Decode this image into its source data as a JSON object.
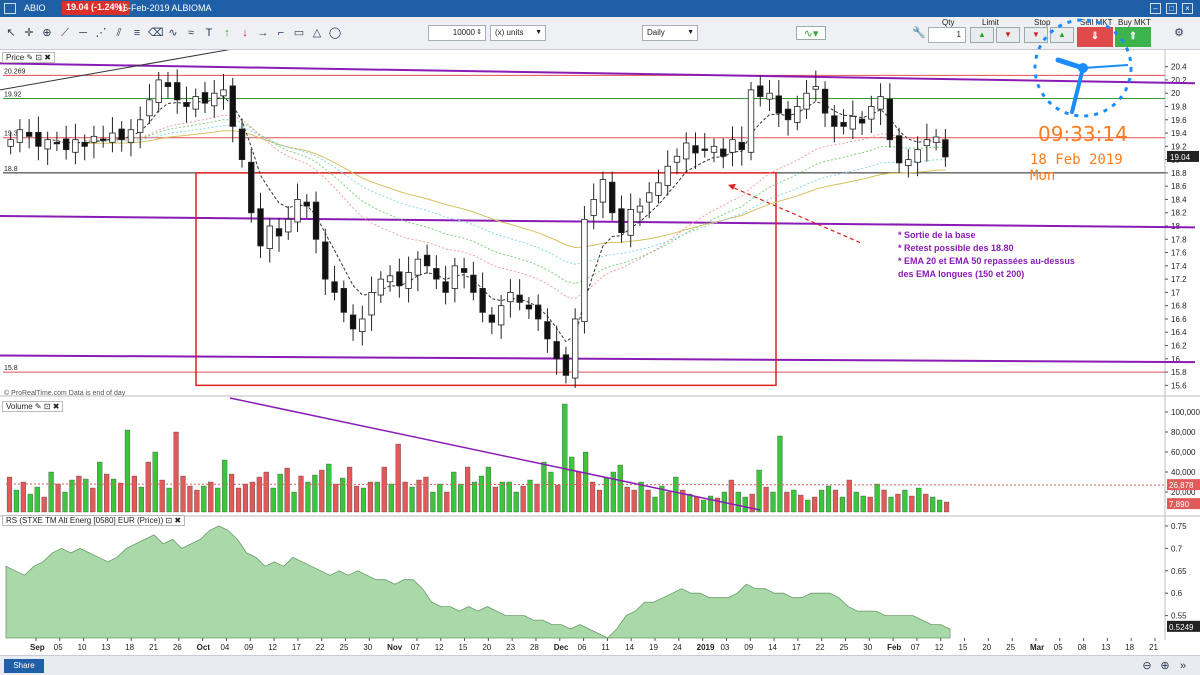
{
  "titlebar": {
    "symbol": "ABIO",
    "price_change": "19.04 (-1.24%)",
    "date_name": "15-Feb-2019 ALBIOMA"
  },
  "toolbar": {
    "quantity": "10000",
    "units": "(x) units",
    "period": "Daily",
    "qty_label": "Qty",
    "qty_value": "1",
    "limit_label": "Limit",
    "stop_label": "Stop",
    "sell_label": "Sell MKT",
    "buy_label": "Buy MKT"
  },
  "clock": {
    "time": "09:33:14",
    "date": "18 Feb 2019 Mon"
  },
  "panels": {
    "price_label": "Price",
    "volume_label": "Volume",
    "rs_label": "RS (STXE TM Alt Energ [0580] EUR (Price))",
    "source_note": "© ProRealTime.com  Data is end of day"
  },
  "bottom": {
    "share_label": "Share"
  },
  "annotations": [
    "* Sortie de la base",
    "* Retest possible des 18.80",
    "* EMA 20 et EMA 50 repassées au-dessus",
    "des EMA longues (150 et 200)"
  ],
  "colors": {
    "up": "#ffffff",
    "down": "#111111",
    "vol_up": "#3cc43c",
    "vol_down": "#e05a5a",
    "rs_fill": "#a9d8a9",
    "purple": "#8a1cb5",
    "box": "#e02020",
    "clock": "#1a8cff",
    "clock_text": "#ff7b1c"
  },
  "chart_data": [
    {
      "type": "candlestick",
      "title": "Price",
      "ylim": [
        15.5,
        20.5
      ],
      "y_ticks": [
        15.6,
        15.8,
        16,
        16.2,
        16.4,
        16.6,
        16.8,
        17,
        17.2,
        17.4,
        17.6,
        17.8,
        18,
        18.2,
        18.4,
        18.6,
        18.8,
        19,
        19.2,
        19.4,
        19.6,
        19.8,
        20,
        20.2,
        20.4
      ],
      "y_tick_labels": [
        "15.6",
        "15.8",
        "16",
        "16.2",
        "16.4",
        "16.6",
        "16.8",
        "17",
        "17.2",
        "17.4",
        "17.6",
        "17.8",
        "18",
        "18.2",
        "18.4",
        "18.6",
        "18.8",
        "19",
        "19.2",
        "19.4",
        "19.6",
        "19.8",
        "20",
        "20.2",
        "20.4"
      ],
      "levels": [
        {
          "value": 20.269,
          "label": "20.269"
        },
        {
          "value": 19.92,
          "label": "19.92"
        },
        {
          "value": 19.33,
          "label": "19.33"
        },
        {
          "value": 18.8,
          "label": "18.8"
        },
        {
          "value": 15.8,
          "label": "15.8"
        }
      ],
      "close_tag": "19.04",
      "closes": [
        19.3,
        19.45,
        19.35,
        19.2,
        19.3,
        19.25,
        19.15,
        19.3,
        19.2,
        19.35,
        19.3,
        19.4,
        19.3,
        19.45,
        19.6,
        19.9,
        20.2,
        20.1,
        19.9,
        19.8,
        19.95,
        19.85,
        20.0,
        20.05,
        19.5,
        19.0,
        18.2,
        17.7,
        18.0,
        17.85,
        18.1,
        18.4,
        18.3,
        17.8,
        17.2,
        17.0,
        16.7,
        16.45,
        16.6,
        17.0,
        17.2,
        17.25,
        17.1,
        17.3,
        17.5,
        17.4,
        17.2,
        17.0,
        17.4,
        17.3,
        17.0,
        16.7,
        16.55,
        16.8,
        17.0,
        16.85,
        16.75,
        16.6,
        16.3,
        16.0,
        15.75,
        16.6,
        18.1,
        18.4,
        18.7,
        18.2,
        17.9,
        18.25,
        18.3,
        18.5,
        18.65,
        18.9,
        19.05,
        19.25,
        19.1,
        19.15,
        19.2,
        19.05,
        19.3,
        19.15,
        20.05,
        19.95,
        20.0,
        19.7,
        19.6,
        19.8,
        20.0,
        20.1,
        19.7,
        19.5,
        19.5,
        19.65,
        19.55,
        19.8,
        19.95,
        19.3,
        18.95,
        19.0,
        19.15,
        19.3,
        19.34,
        19.04
      ],
      "series": [
        {
          "name": "EMA 20"
        },
        {
          "name": "EMA 50"
        },
        {
          "name": "EMA 150"
        },
        {
          "name": "EMA 200"
        }
      ]
    },
    {
      "type": "bar",
      "title": "Volume",
      "ylim": [
        0,
        110000
      ],
      "y_ticks": [
        20000,
        40000,
        60000,
        80000,
        100000
      ],
      "y_tick_labels": [
        "20,000",
        "40,000",
        "60,000",
        "80,000",
        "100,000"
      ],
      "tag_values": [
        "26,878",
        "7,890"
      ],
      "values": [
        35000,
        22000,
        30000,
        18000,
        25000,
        15000,
        40000,
        28000,
        20000,
        32000,
        36000,
        33000,
        24000,
        50000,
        38000,
        33000,
        29000,
        82000,
        36000,
        25000,
        50000,
        60000,
        32000,
        24000,
        80000,
        36000,
        26000,
        22000,
        26000,
        30000,
        24000,
        52000,
        38000,
        24000,
        28000,
        30000,
        35000,
        40000,
        24000,
        38000,
        44000,
        20000,
        36000,
        30000,
        37000,
        42000,
        48000,
        28000,
        34000,
        45000,
        26000,
        24000,
        30000,
        30000,
        45000,
        28000,
        68000,
        30000,
        25000,
        32000,
        35000,
        20000,
        28000,
        20000,
        40000,
        28000,
        45000,
        30000,
        36000,
        45000,
        25000,
        30000,
        30000,
        20000,
        26000,
        32000,
        28000,
        50000,
        40000,
        27000,
        108000,
        55000,
        40000,
        60000,
        30000,
        22000,
        34000,
        40000,
        47000,
        25000,
        22000,
        30000,
        22000,
        15000,
        26000,
        20000,
        35000,
        22000,
        18000,
        15000,
        12000,
        16000,
        14000,
        20000,
        32000,
        20000,
        15000,
        18000,
        42000,
        25000,
        20000,
        76000,
        20000,
        22000,
        17000,
        12000,
        15000,
        22000,
        26000,
        22000,
        15000,
        32000,
        20000,
        16000,
        15000,
        28000,
        22000,
        15000,
        18000,
        22000,
        16000,
        24000,
        18000,
        15000,
        12000,
        10000
      ],
      "colors": [
        "down",
        "up",
        "down",
        "up",
        "up",
        "down",
        "up",
        "down",
        "up",
        "up",
        "down",
        "up",
        "down",
        "up",
        "down",
        "up",
        "down",
        "up",
        "down",
        "up",
        "down",
        "up",
        "down",
        "up",
        "down",
        "down",
        "down",
        "down",
        "up",
        "down",
        "up",
        "up",
        "down",
        "down",
        "down",
        "down",
        "down",
        "down",
        "up",
        "up",
        "down",
        "up",
        "down",
        "up",
        "up",
        "down",
        "up",
        "down",
        "up",
        "down",
        "down",
        "up",
        "down",
        "up",
        "down",
        "up",
        "down",
        "down",
        "up",
        "down",
        "down",
        "up",
        "up",
        "down",
        "up",
        "up",
        "down",
        "up",
        "up",
        "up",
        "down",
        "up",
        "up",
        "up",
        "down",
        "up",
        "down",
        "up",
        "up",
        "down",
        "up",
        "up",
        "down",
        "up",
        "down",
        "down",
        "up",
        "up",
        "up",
        "down",
        "down",
        "up",
        "down",
        "up",
        "up",
        "down",
        "up",
        "down",
        "up",
        "down",
        "up",
        "up",
        "down",
        "up",
        "down",
        "up",
        "up",
        "down",
        "up",
        "down",
        "up",
        "up",
        "down",
        "up",
        "down",
        "up",
        "down",
        "up",
        "up",
        "down",
        "up",
        "down",
        "up",
        "up",
        "down",
        "up",
        "down",
        "up",
        "down",
        "up",
        "down",
        "up",
        "down",
        "up",
        "up",
        "down",
        "up"
      ]
    },
    {
      "type": "area",
      "title": "RS (STXE TM Alt Energ [0580] EUR (Price))",
      "ylim": [
        0.5,
        0.77
      ],
      "y_ticks": [
        0.55,
        0.6,
        0.65,
        0.7,
        0.75
      ],
      "y_tick_labels": [
        "0.55",
        "0.6",
        "0.65",
        "0.7",
        "0.75"
      ],
      "tag_value": "0.5249",
      "values": [
        0.66,
        0.65,
        0.64,
        0.66,
        0.67,
        0.69,
        0.7,
        0.69,
        0.7,
        0.69,
        0.68,
        0.67,
        0.68,
        0.7,
        0.71,
        0.72,
        0.73,
        0.71,
        0.72,
        0.7,
        0.71,
        0.72,
        0.74,
        0.75,
        0.74,
        0.72,
        0.69,
        0.68,
        0.66,
        0.67,
        0.66,
        0.68,
        0.67,
        0.66,
        0.65,
        0.64,
        0.65,
        0.64,
        0.65,
        0.64,
        0.63,
        0.63,
        0.62,
        0.63,
        0.63,
        0.61,
        0.58,
        0.57,
        0.57,
        0.56,
        0.57,
        0.56,
        0.57,
        0.56,
        0.55,
        0.55,
        0.55,
        0.54,
        0.54,
        0.53,
        0.53,
        0.52,
        0.53,
        0.52,
        0.51,
        0.5,
        0.52,
        0.55,
        0.56,
        0.58,
        0.58,
        0.59,
        0.6,
        0.61,
        0.6,
        0.6,
        0.59,
        0.59,
        0.59,
        0.6,
        0.62,
        0.61,
        0.61,
        0.6,
        0.6,
        0.59,
        0.59,
        0.6,
        0.6,
        0.6,
        0.59,
        0.57,
        0.56,
        0.56,
        0.56,
        0.55,
        0.55,
        0.55,
        0.55,
        0.54,
        0.53,
        0.53,
        0.52
      ]
    }
  ],
  "x_axis": {
    "labels": [
      "Sep",
      "05",
      "10",
      "13",
      "18",
      "21",
      "26",
      "Oct",
      "04",
      "09",
      "12",
      "17",
      "22",
      "25",
      "30",
      "Nov",
      "07",
      "12",
      "15",
      "20",
      "23",
      "28",
      "Dec",
      "06",
      "11",
      "14",
      "19",
      "24",
      "2019",
      "03",
      "09",
      "14",
      "17",
      "22",
      "25",
      "30",
      "Feb",
      "07",
      "12",
      "15",
      "20",
      "25",
      "Mar",
      "05",
      "08",
      "13",
      "18",
      "21"
    ]
  }
}
